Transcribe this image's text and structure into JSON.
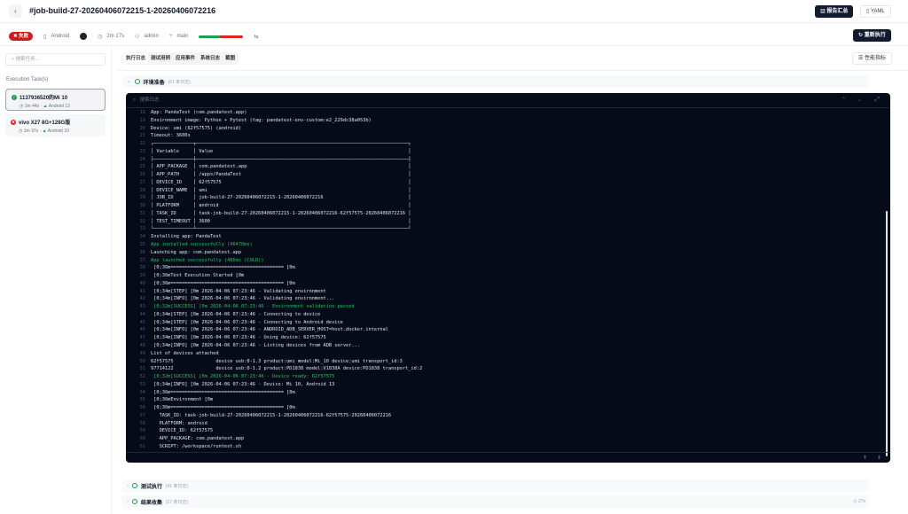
{
  "header": {
    "title": "#job-build-27-20260406072215-1-20260406072216",
    "report_label": "报告汇总",
    "yaml_label": "YAML"
  },
  "meta": {
    "status": "失败",
    "platform": "Android",
    "duration": "2m 17s",
    "user": "admin",
    "branch": "main",
    "progress_pass_fraction": 0.48,
    "rerun_label": "重新执行",
    "colors": {
      "fail": "#c81e1e",
      "pass": "#16a34a"
    }
  },
  "sidebar": {
    "search_placeholder": "搜索任务...",
    "section_title": "Execution Task(s)",
    "tasks": [
      {
        "name": "1137936520的Mi 10",
        "duration": "1m 44s",
        "os": "Android 13",
        "status": "success"
      },
      {
        "name": "vivo X27 8G+128G版",
        "duration": "1m 37s",
        "os": "Android 10",
        "status": "failed"
      }
    ]
  },
  "tabs": [
    "执行日志",
    "测试用例",
    "应用事件",
    "系统日志",
    "截图"
  ],
  "perf_label": "性能指标",
  "sections": [
    {
      "name": "环境准备",
      "count": "(61 条日志)"
    },
    {
      "name": "测试执行",
      "count": "(41 条日志)"
    },
    {
      "name": "结果收集",
      "count": "(17 条日志)",
      "time": "27s"
    }
  ],
  "log": {
    "search_placeholder": "搜索日志",
    "lines": [
      {
        "n": "18",
        "t": "App: PandaTest (com.pandatest.app)"
      },
      {
        "n": "19",
        "t": "Environment image: Python + Pytest (tag: pandatest-env-custom:e2_229dc38a053b)"
      },
      {
        "n": "20",
        "t": "Device: umi (62f57575) (android)"
      },
      {
        "n": "21",
        "t": "Timeout: 3600s"
      },
      {
        "n": "22",
        "t": "┌──────────────┬───────────────────────────────────────────────────────────────────────────┐"
      },
      {
        "n": "23",
        "t": "│ Variable     │ Value                                                                     │"
      },
      {
        "n": "24",
        "t": "├──────────────┼───────────────────────────────────────────────────────────────────────────┤"
      },
      {
        "n": "25",
        "t": "│ APP_PACKAGE  │ com.pandatest.app                                                         │"
      },
      {
        "n": "26",
        "t": "│ APP_PATH     │ /apps/PandaTest                                                           │"
      },
      {
        "n": "27",
        "t": "│ DEVICE_ID    │ 62f57575                                                                  │"
      },
      {
        "n": "28",
        "t": "│ DEVICE_NAME  │ umi                                                                       │"
      },
      {
        "n": "29",
        "t": "│ JOB_ID       │ job-build-27-20260406072215-1-20260406072216                              │"
      },
      {
        "n": "30",
        "t": "│ PLATFORM     │ android                                                                   │"
      },
      {
        "n": "31",
        "t": "│ TASK_ID      │ task-job-build-27-20260406072215-1-20260406072216-62f57575-20260406072216 │"
      },
      {
        "n": "32",
        "t": "│ TEST_TIMEOUT │ 3600                                                                      │"
      },
      {
        "n": "33",
        "t": "└──────────────┴───────────────────────────────────────────────────────────────────────────┘"
      },
      {
        "n": "34",
        "t": "Installing app: PandaTest"
      },
      {
        "n": "35",
        "t": "App installed successfully (4647Oms)",
        "g": true
      },
      {
        "n": "36",
        "t": "Launching app: com.pandatest.app"
      },
      {
        "n": "37",
        "t": "App launched successfully (486ms (COLD))",
        "g": true
      },
      {
        "n": "38",
        "t": " [0;36m======================================== [0m"
      },
      {
        "n": "39",
        "t": " [0;36mTest Execution Started [0m"
      },
      {
        "n": "40",
        "t": " [0;36m======================================== [0m"
      },
      {
        "n": "41",
        "t": " [0;34m[STEP] [0m 2026-04-06 07:23:46 - Validating environment"
      },
      {
        "n": "42",
        "t": " [0;34m[INFO] [0m 2026-04-06 07:23:46 - Validating environment..."
      },
      {
        "n": "43",
        "t": " [0;32m[SUCCESS] [0m 2026-04-06 07:23:46 - Environment validation passed",
        "g": true
      },
      {
        "n": "44",
        "t": " [0;34m[STEP] [0m 2026-04-06 07:23:46 - Connecting to device"
      },
      {
        "n": "45",
        "t": " [0;34m[STEP] [0m 2026-04-06 07:23:46 - Connecting to Android device"
      },
      {
        "n": "46",
        "t": " [0;34m[INFO] [0m 2026-04-06 07:23:46 - ANDROID_ADB_SERVER_HOST=host.docker.internal"
      },
      {
        "n": "47",
        "t": " [0;34m[INFO] [0m 2026-04-06 07:23:46 - Using device: 62f57575"
      },
      {
        "n": "48",
        "t": " [0;34m[INFO] [0m 2026-04-06 07:23:46 - Listing devices from ADB server..."
      },
      {
        "n": "49",
        "t": "List of devices attached"
      },
      {
        "n": "50",
        "t": "62f57575               device usb:0-1.3 product:umi model:Mi_10 device:umi transport_id:3"
      },
      {
        "n": "51",
        "t": "97714122               device usb:0-1.2 product:PD1838 model:V1838A device:PD1838 transport_id:2"
      },
      {
        "n": "52",
        "t": " [0;32m[SUCCESS] [0m 2026-04-06 07:23:46 - Device ready: 62f57575",
        "g": true
      },
      {
        "n": "53",
        "t": " [0;34m[INFO] [0m 2026-04-06 07:23:46 - Device: Mi 10, Android 13"
      },
      {
        "n": "54",
        "t": " [0;36m======================================== [0m"
      },
      {
        "n": "55",
        "t": " [0;36mEnvironment [0m"
      },
      {
        "n": "56",
        "t": " [0;36m======================================== [0m"
      },
      {
        "n": "57",
        "t": "   TASK_ID: task-job-build-27-20260406072215-1-20260406072216-62f57575-20260406072216"
      },
      {
        "n": "58",
        "t": "   PLATFORM: android"
      },
      {
        "n": "59",
        "t": "   DEVICE_ID: 62f57575"
      },
      {
        "n": "60",
        "t": "   APP_PACKAGE: com.pandatest.app"
      },
      {
        "n": "61",
        "t": "   SCRIPT: /workspace/runtest.sh"
      }
    ]
  }
}
